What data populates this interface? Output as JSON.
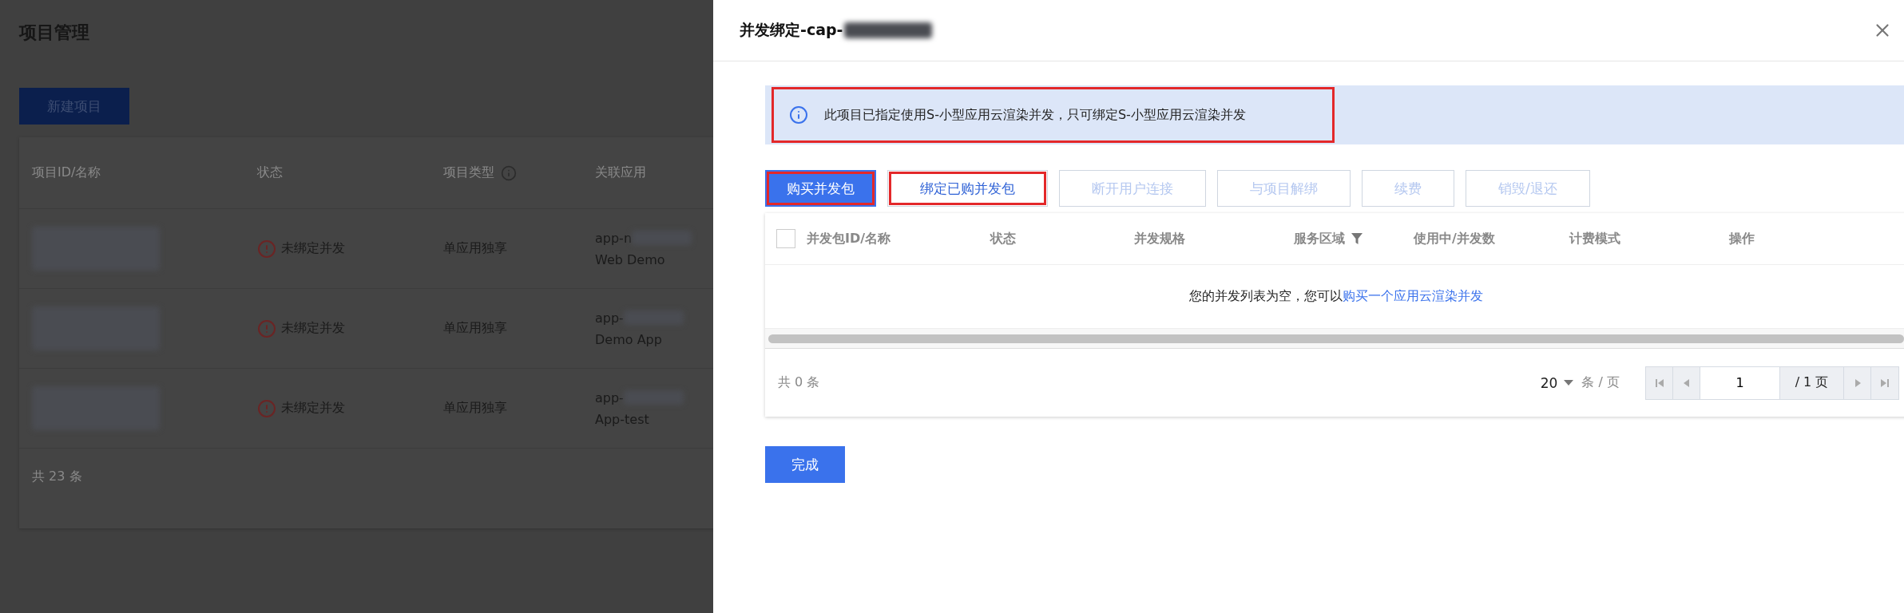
{
  "background_page": {
    "title": "项目管理",
    "new_button": "新建项目",
    "table": {
      "columns": [
        {
          "label": "项目ID/名称",
          "info": false
        },
        {
          "label": "状态",
          "info": false
        },
        {
          "label": "项目类型",
          "info": true
        },
        {
          "label": "关联应用",
          "info": false
        }
      ],
      "rows": [
        {
          "status": "未绑定并发",
          "type": "单应用独享",
          "app_id": "app-n",
          "app_name": "Web Demo"
        },
        {
          "status": "未绑定并发",
          "type": "单应用独享",
          "app_id": "app-",
          "app_name": "Demo App"
        },
        {
          "status": "未绑定并发",
          "type": "单应用独享",
          "app_id": "app-",
          "app_name": "App-test"
        }
      ],
      "footer": "共 23 条"
    }
  },
  "dialog": {
    "title": "并发绑定-cap-",
    "alert": {
      "text": "此项目已指定使用S-小型应用云渲染并发，只可绑定S-小型应用云渲染并发",
      "highlighted": true
    },
    "buttons": [
      {
        "label": "购买并发包",
        "kind": "primary",
        "disabled": false,
        "highlighted": true
      },
      {
        "label": "绑定已购并发包",
        "kind": "default",
        "disabled": false,
        "highlighted": true
      },
      {
        "label": "断开用户连接",
        "kind": "default",
        "disabled": true,
        "highlighted": false
      },
      {
        "label": "与项目解绑",
        "kind": "default",
        "disabled": true,
        "highlighted": false
      },
      {
        "label": "续费",
        "kind": "default",
        "disabled": true,
        "highlighted": false
      },
      {
        "label": "销毁/退还",
        "kind": "default",
        "disabled": true,
        "highlighted": false
      }
    ],
    "table": {
      "select_all": {
        "checked": false
      },
      "columns": [
        {
          "label": "并发包ID/名称",
          "filter": false
        },
        {
          "label": "状态",
          "filter": false
        },
        {
          "label": "并发规格",
          "filter": false
        },
        {
          "label": "服务区域",
          "filter": true
        },
        {
          "label": "使用中/并发数",
          "filter": false
        },
        {
          "label": "计费模式",
          "filter": false
        },
        {
          "label": "操作",
          "filter": false
        }
      ],
      "empty_text": "您的并发列表为空，您可以",
      "empty_link": "购买一个应用云渲染并发",
      "total": "共 0 条",
      "page_size": "20",
      "page_size_unit": "条 / 页",
      "page": "1",
      "page_total": "/ 1 页"
    },
    "done_button": "完成"
  }
}
